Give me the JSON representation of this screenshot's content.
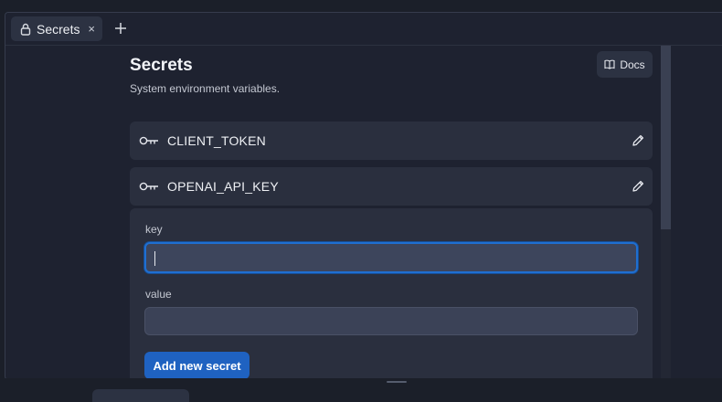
{
  "tabs": {
    "active_label": "Secrets",
    "close_glyph": "×",
    "lock_icon": "lock-icon",
    "add_icon": "plus-icon"
  },
  "header": {
    "title": "Secrets",
    "subtitle": "System environment variables.",
    "docs_label": "Docs",
    "docs_icon": "book-icon"
  },
  "secrets": [
    {
      "name": "CLIENT_TOKEN",
      "icon": "key-icon",
      "action_icon": "pencil-icon"
    },
    {
      "name": "OPENAI_API_KEY",
      "icon": "key-icon",
      "action_icon": "pencil-icon"
    }
  ],
  "form": {
    "key_label": "key",
    "key_value": "",
    "value_label": "value",
    "value_value": "",
    "submit_label": "Add new secret"
  },
  "colors": {
    "background": "#1e2230",
    "card": "#2a2f3e",
    "input": "#3b4257",
    "focus_ring": "#1f6fd1",
    "primary_button": "#1f62c1"
  }
}
